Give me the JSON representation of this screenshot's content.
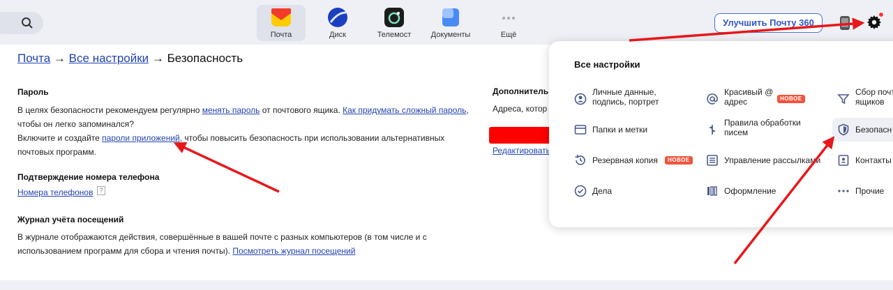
{
  "apps": [
    {
      "label": "Почта",
      "active": true
    },
    {
      "label": "Диск",
      "active": false
    },
    {
      "label": "Телемост",
      "active": false
    },
    {
      "label": "Документы",
      "active": false
    },
    {
      "label": "Ещё",
      "active": false
    }
  ],
  "header": {
    "upgrade_label": "Улучшить Почту 360"
  },
  "breadcrumb": {
    "mail": "Почта",
    "arrow": " → ",
    "all_settings": "Все настройки",
    "current": "Безопасность"
  },
  "password": {
    "title": "Пароль",
    "p1_a": "В целях безопасности рекомендуем регулярно ",
    "p1_link1": "менять пароль",
    "p1_b": " от почтового ящика. ",
    "p1_link2": "Как придумать сложный пароль",
    "p1_c": ",",
    "p1_d": "чтобы он легко запоминался?",
    "p2_a": "Включите и создайте ",
    "p2_link": "пароли приложений",
    "p2_b": ", чтобы повысить безопасность при использовании альтернативных",
    "p2_c": "почтовых программ."
  },
  "phone": {
    "title": "Подтверждение номера телефона",
    "link": "Номера телефонов",
    "help": "?"
  },
  "journal": {
    "title": "Журнал учёта посещений",
    "p_a": "В журнале отображаются действия, совершённые в вашей почте с разных компьютеров (в том числе и с",
    "p_b": "использованием программ для сбора и чтения почты). ",
    "p_link": "Посмотреть журнал посещений"
  },
  "extra": {
    "title": "Дополнитель",
    "text": "Адреса, котор",
    "edit_link": "Редактировать"
  },
  "dropdown": {
    "title": "Все настройки",
    "badge": "НОВОЕ",
    "col1": [
      {
        "label": "Личные данные,\nподпись, портрет",
        "icon": "user-circle-icon"
      },
      {
        "label": "Папки и метки",
        "icon": "folder-icon"
      },
      {
        "label": "Резервная копия",
        "icon": "history-icon"
      },
      {
        "label": "Дела",
        "icon": "check-circle-icon"
      }
    ],
    "col2": [
      {
        "label": "Красивый @\nадрес",
        "icon": "at-icon"
      },
      {
        "label": "Правила обработки\nписем",
        "icon": "rules-icon"
      },
      {
        "label": "Управление рассылками",
        "icon": "list-icon"
      },
      {
        "label": "Оформление",
        "icon": "theme-icon"
      }
    ],
    "col3": [
      {
        "label": "Сбор почт\nящиков",
        "icon": "funnel-icon"
      },
      {
        "label": "Безопасн",
        "icon": "shield-icon"
      },
      {
        "label": "Контакты",
        "icon": "contacts-icon"
      },
      {
        "label": "Прочие",
        "icon": "dots-icon"
      }
    ]
  },
  "colors": {
    "link": "#2343b0",
    "accent": "#2f56cc",
    "annotation": "#e8171b",
    "badge": "#f0553d"
  }
}
